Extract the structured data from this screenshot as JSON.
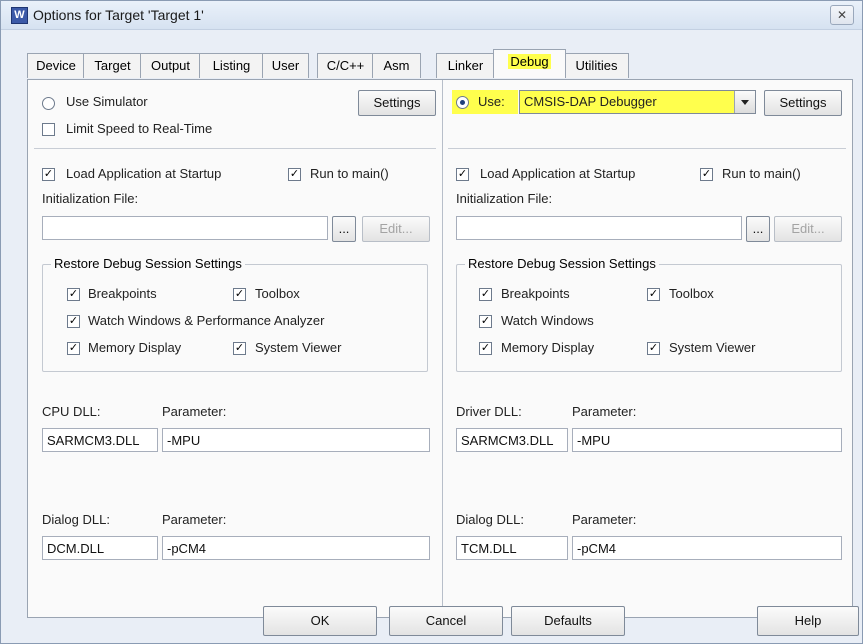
{
  "window": {
    "title": "Options for Target 'Target 1'",
    "close_glyph": "✕",
    "app_icon_letter": "W"
  },
  "tabs": [
    "Device",
    "Target",
    "Output",
    "Listing",
    "User",
    "C/C++",
    "Asm",
    "Linker",
    "Debug",
    "Utilities"
  ],
  "left": {
    "use_simulator": "Use Simulator",
    "limit_speed": "Limit Speed to Real-Time",
    "settings": "Settings",
    "load_app": "Load Application at Startup",
    "run_to_main": "Run to main()",
    "init_file_label": "Initialization File:",
    "init_file_value": "",
    "browse": "...",
    "edit": "Edit...",
    "restore_title": "Restore Debug Session Settings",
    "breakpoints": "Breakpoints",
    "toolbox": "Toolbox",
    "watch": "Watch Windows & Performance Analyzer",
    "memory": "Memory Display",
    "system_viewer": "System Viewer",
    "dll1_label": "CPU DLL:",
    "param1_label": "Parameter:",
    "dll1_value": "SARMCM3.DLL",
    "param1_value": "-MPU",
    "dll2_label": "Dialog DLL:",
    "param2_label": "Parameter:",
    "dll2_value": "DCM.DLL",
    "param2_value": "-pCM4"
  },
  "right": {
    "use": "Use:",
    "debugger": "CMSIS-DAP Debugger",
    "settings": "Settings",
    "load_app": "Load Application at Startup",
    "run_to_main": "Run to main()",
    "init_file_label": "Initialization File:",
    "init_file_value": "",
    "browse": "...",
    "edit": "Edit...",
    "restore_title": "Restore Debug Session Settings",
    "breakpoints": "Breakpoints",
    "toolbox": "Toolbox",
    "watch": "Watch Windows",
    "memory": "Memory Display",
    "system_viewer": "System Viewer",
    "dll1_label": "Driver DLL:",
    "param1_label": "Parameter:",
    "dll1_value": "SARMCM3.DLL",
    "param1_value": "-MPU",
    "dll2_label": "Dialog DLL:",
    "param2_label": "Parameter:",
    "dll2_value": "TCM.DLL",
    "param2_value": "-pCM4"
  },
  "footer": {
    "ok": "OK",
    "cancel": "Cancel",
    "defaults": "Defaults",
    "help": "Help"
  },
  "check_glyph": "✓",
  "colors": {
    "highlight": "#ffff4d",
    "title_bar": "#d6e2f1"
  }
}
